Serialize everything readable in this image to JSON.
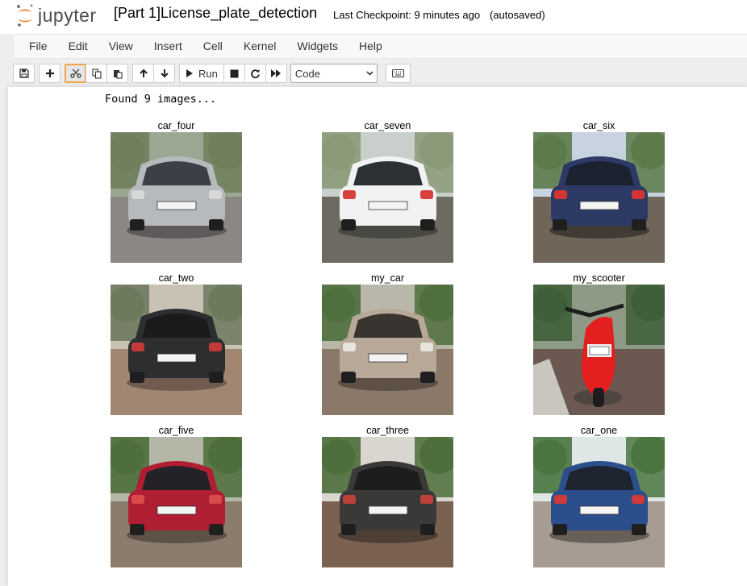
{
  "header": {
    "logo_text": "jupyter",
    "notebook_title": "[Part 1]License_plate_detection",
    "checkpoint": "Last Checkpoint: 9 minutes ago",
    "autosave_status": "(autosaved)"
  },
  "menubar": {
    "items": [
      "File",
      "Edit",
      "View",
      "Insert",
      "Cell",
      "Kernel",
      "Widgets",
      "Help"
    ]
  },
  "toolbar": {
    "save_icon": "floppy-disk-icon",
    "insert_icon": "plus-icon",
    "cut_icon": "scissors-icon",
    "copy_icon": "copy-icon",
    "paste_icon": "paste-icon",
    "move_up_icon": "arrow-up-icon",
    "move_down_icon": "arrow-down-icon",
    "run_label": "Run",
    "interrupt_icon": "stop-icon",
    "restart_icon": "restart-icon",
    "run_all_icon": "fast-forward-icon",
    "cell_type": "Code",
    "command_palette_icon": "keyboard-icon"
  },
  "output": {
    "text": "Found 9 images...",
    "images": [
      {
        "title": "car_four",
        "palette": {
          "sky": "#9aa792",
          "bg": "#6f7f5c",
          "ground": "#8c8684",
          "body": "#b7babd",
          "window": "#3a4046",
          "light": "#d6d8d9",
          "shadow": "#4a4748"
        }
      },
      {
        "title": "car_seven",
        "palette": {
          "sky": "#c9d0cc",
          "bg": "#8a9a78",
          "ground": "#6d6a62",
          "body": "#f2f2f2",
          "window": "#2c3136",
          "light": "#d7403c",
          "shadow": "#3b3a36"
        }
      },
      {
        "title": "car_six",
        "palette": {
          "sky": "#c7d4e0",
          "bg": "#5c7a4a",
          "ground": "#6f6659",
          "body": "#2d3a66",
          "window": "#1c2230",
          "light": "#d33434",
          "shadow": "#2e2a27"
        }
      },
      {
        "title": "car_two",
        "palette": {
          "sky": "#c8c2b4",
          "bg": "#6d7a5e",
          "ground": "#a18672",
          "body": "#2d2e30",
          "window": "#1a1b1d",
          "light": "#c23a3a",
          "shadow": "#5a4a40"
        }
      },
      {
        "title": "my_car",
        "palette": {
          "sky": "#b9b7aa",
          "bg": "#4f6f3d",
          "ground": "#8a7868",
          "body": "#b8a898",
          "window": "#383530",
          "light": "#e8e4dc",
          "shadow": "#4a4038"
        }
      },
      {
        "title": "my_scooter",
        "palette": {
          "sky": "#8e9a86",
          "bg": "#3f5f3a",
          "ground": "#6b5850",
          "body": "#e41f20",
          "window": "#1d1d1d",
          "light": "#f2f2f2",
          "shadow": "#3d3a37"
        }
      },
      {
        "title": "car_five",
        "palette": {
          "sky": "#b5b7a6",
          "bg": "#4e6e3b",
          "ground": "#8b7c6c",
          "body": "#b01e33",
          "window": "#242228",
          "light": "#d94b4b",
          "shadow": "#4a4036"
        }
      },
      {
        "title": "car_three",
        "palette": {
          "sky": "#d8d6cf",
          "bg": "#4e6e3b",
          "ground": "#7a6150",
          "body": "#3b3938",
          "window": "#1e1d1d",
          "light": "#c0403c",
          "shadow": "#3c302a"
        }
      },
      {
        "title": "car_one",
        "palette": {
          "sky": "#dfe6e6",
          "bg": "#4a7440",
          "ground": "#a79c92",
          "body": "#2b4e8c",
          "window": "#1f2530",
          "light": "#cf3a3a",
          "shadow": "#4d4640"
        }
      }
    ]
  }
}
